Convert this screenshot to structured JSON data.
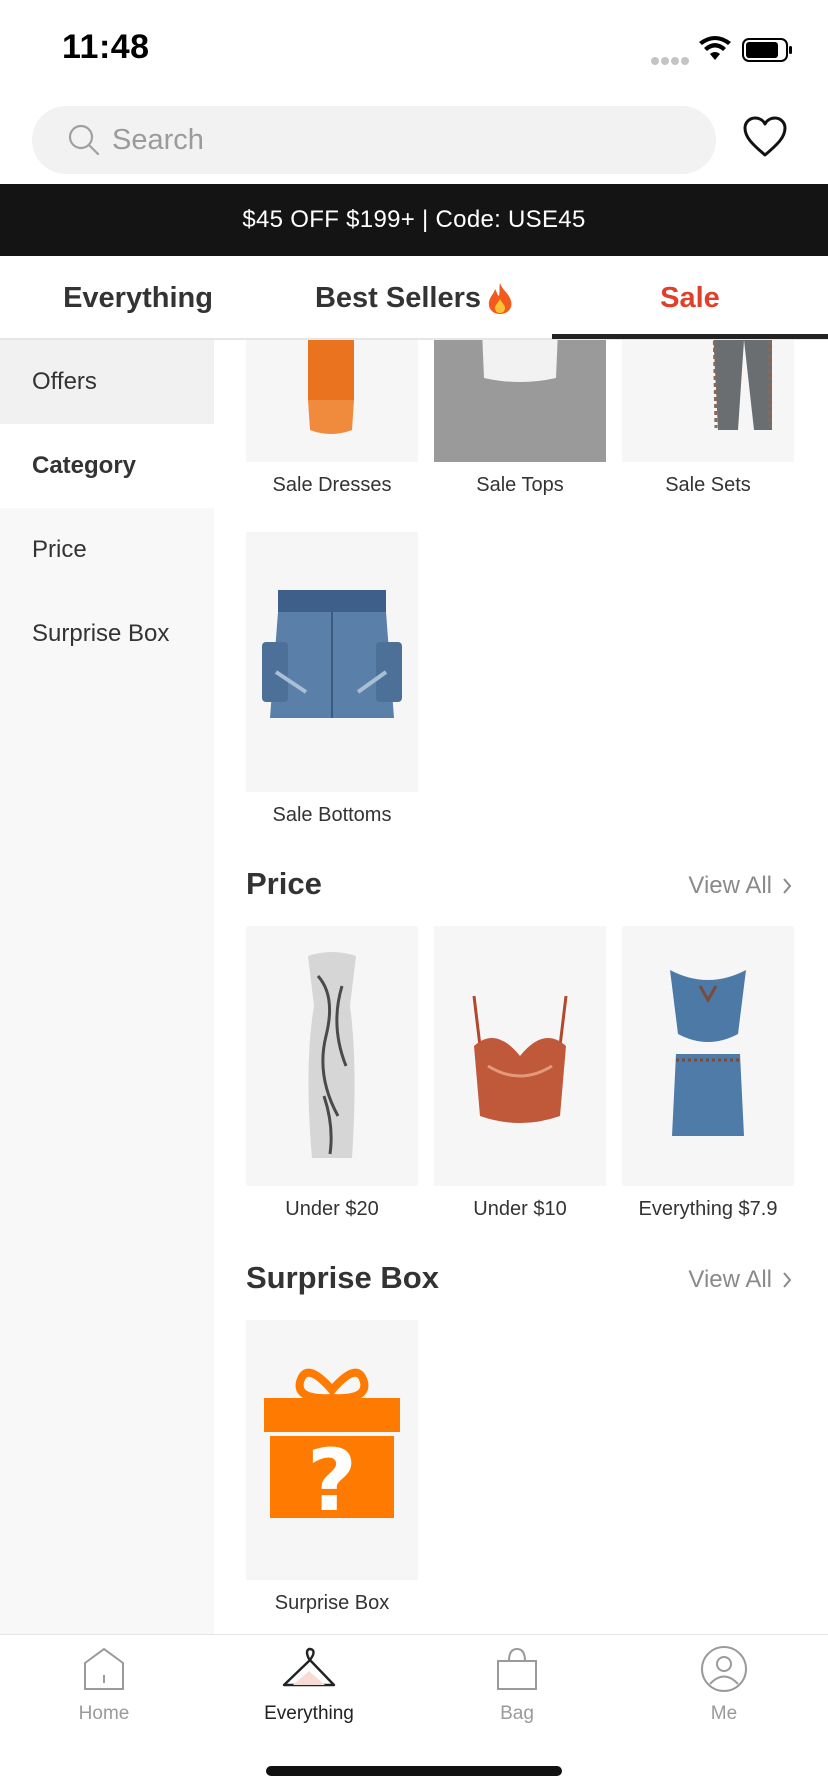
{
  "status_bar": {
    "time": "11:48"
  },
  "search": {
    "placeholder": "Search"
  },
  "promo": {
    "text": "$45 OFF $199+ | Code: USE45"
  },
  "tabs": [
    {
      "label": "Everything",
      "active": false
    },
    {
      "label": "Best Sellers",
      "active": false,
      "icon": "fire-icon"
    },
    {
      "label": "Sale",
      "active": true
    }
  ],
  "sidebar": {
    "items": [
      {
        "label": "Offers"
      },
      {
        "label": "Category",
        "active": true
      },
      {
        "label": "Price"
      },
      {
        "label": "Surprise Box"
      }
    ]
  },
  "category_section": {
    "items": [
      {
        "label": "Sale Dresses",
        "icon": "orange-dress-image"
      },
      {
        "label": "Sale Tops",
        "icon": "white-top-image"
      },
      {
        "label": "Sale Sets",
        "icon": "grey-pants-image"
      },
      {
        "label": "Sale Bottoms",
        "icon": "denim-skirt-image"
      }
    ]
  },
  "price_section": {
    "title": "Price",
    "view_all": "View All",
    "items": [
      {
        "label": "Under $20",
        "icon": "silver-dress-image"
      },
      {
        "label": "Under $10",
        "icon": "lace-cami-image"
      },
      {
        "label": "Everything $7.9",
        "icon": "denim-set-image"
      }
    ]
  },
  "surprise_section": {
    "title": "Surprise Box",
    "view_all": "View All",
    "items": [
      {
        "label": "Surprise Box",
        "icon": "gift-box-image"
      }
    ]
  },
  "bottom_nav": [
    {
      "label": "Home",
      "icon": "home-icon"
    },
    {
      "label": "Everything",
      "icon": "hanger-icon",
      "active": true
    },
    {
      "label": "Bag",
      "icon": "bag-icon"
    },
    {
      "label": "Me",
      "icon": "profile-icon"
    }
  ],
  "colors": {
    "accent_sale": "#e0402a",
    "banner_bg": "#141414",
    "gift_orange": "#ff7a00"
  }
}
